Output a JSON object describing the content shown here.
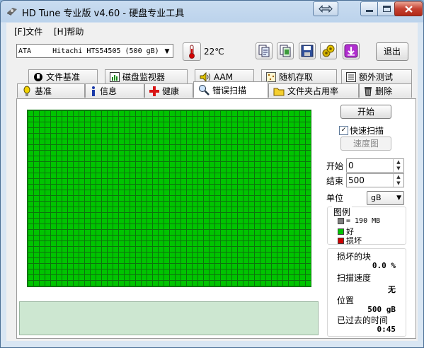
{
  "window": {
    "title": "HD Tune 专业版 v4.60 - 硬盘专业工具"
  },
  "menu": [
    {
      "label": "[F]文件"
    },
    {
      "label": "[H]帮助"
    }
  ],
  "toolbar": {
    "drive": "ATA     Hitachi HTS54505 (500 gB)",
    "temperature": "22℃",
    "icons": [
      "copy-info-icon",
      "copy-all-icon",
      "save-icon",
      "options-icon",
      "download-icon"
    ],
    "exit_label": "退出"
  },
  "tabs_top": [
    {
      "label": "文件基准",
      "icon": "file-benchmark-icon"
    },
    {
      "label": "磁盘监视器",
      "icon": "disk-monitor-icon"
    },
    {
      "label": "AAM",
      "icon": "speaker-icon"
    },
    {
      "label": "随机存取",
      "icon": "random-access-icon"
    },
    {
      "label": "额外测试",
      "icon": "extra-tests-icon"
    }
  ],
  "tabs_bottom": [
    {
      "label": "基准",
      "icon": "benchmark-icon"
    },
    {
      "label": "信息",
      "icon": "info-icon"
    },
    {
      "label": "健康",
      "icon": "health-icon"
    },
    {
      "label": "错误扫描",
      "icon": "error-scan-icon",
      "active": true
    },
    {
      "label": "文件夹占用率",
      "icon": "folder-usage-icon"
    },
    {
      "label": "删除",
      "icon": "erase-icon"
    }
  ],
  "scan": {
    "start_button": "开始",
    "quick_scan_label": "快速扫描",
    "quick_scan_checked": true,
    "speed_map_button": "速度图",
    "start_label": "开始",
    "start_value": "0",
    "end_label": "结束",
    "end_value": "500",
    "unit_label": "单位",
    "unit_value": "gB"
  },
  "legend": {
    "title": "图例",
    "block_size": "= 190 MB",
    "good_label": "好",
    "bad_label": "损坏",
    "colors": {
      "block": "#808080",
      "good": "#00c400",
      "bad": "#d00000"
    }
  },
  "stats": {
    "damaged_label": "损坏的块",
    "damaged_value": "0.0 %",
    "speed_label": "扫描速度",
    "speed_value": "无",
    "position_label": "位置",
    "position_value": "500 gB",
    "elapsed_label": "已过去的时间",
    "elapsed_value": "0:45"
  }
}
